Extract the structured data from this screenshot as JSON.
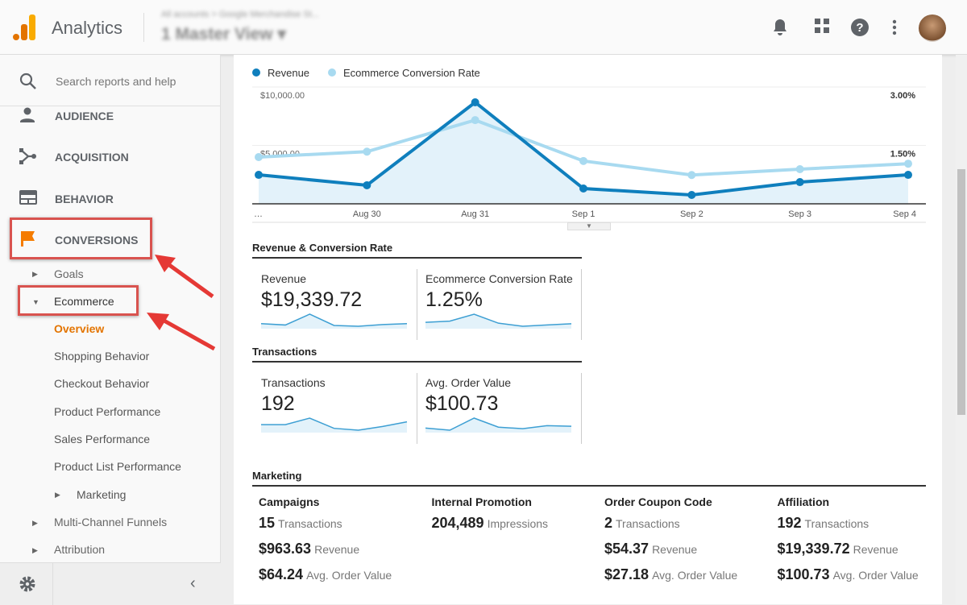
{
  "header": {
    "app_title": "Analytics",
    "breadcrumb": "All accounts > Google Merchandise St...",
    "view": "1 Master View ▾",
    "icons": [
      "bell-icon",
      "apps-grid-icon",
      "help-icon",
      "more-vert-icon"
    ]
  },
  "sidebar": {
    "search_placeholder": "Search reports and help",
    "sections": [
      {
        "label": "AUDIENCE",
        "icon": "person-icon"
      },
      {
        "label": "ACQUISITION",
        "icon": "acquisition-icon"
      },
      {
        "label": "BEHAVIOR",
        "icon": "behavior-icon"
      },
      {
        "label": "CONVERSIONS",
        "icon": "flag-icon"
      }
    ],
    "goals": "Goals",
    "ecommerce": "Ecommerce",
    "ecommerce_items": [
      "Overview",
      "Shopping Behavior",
      "Checkout Behavior",
      "Product Performance",
      "Sales Performance",
      "Product List Performance"
    ],
    "marketing": "Marketing",
    "multi_channel": "Multi-Channel Funnels",
    "attribution": "Attribution",
    "active_color": "#e37400"
  },
  "chart_data": {
    "type": "line",
    "categories": [
      "…",
      "Aug 30",
      "Aug 31",
      "Sep 1",
      "Sep 2",
      "Sep 3",
      "Sep 4"
    ],
    "series": [
      {
        "name": "Revenue",
        "color": "#0f7fbd",
        "axis": "left",
        "area": true,
        "values": [
          2480,
          1590,
          8690,
          1310,
          760,
          1860,
          2480
        ]
      },
      {
        "name": "Ecommerce Conversion Rate",
        "color": "#a8daf0",
        "axis": "right",
        "values": [
          1.2,
          1.34,
          2.15,
          1.1,
          0.74,
          0.89,
          1.03
        ]
      }
    ],
    "y_left": {
      "ticks": [
        "$10,000.00",
        "$5,000.00"
      ],
      "range": [
        0,
        10000
      ]
    },
    "y_right": {
      "ticks": [
        "3.00%",
        "1.50%"
      ],
      "range": [
        0,
        3
      ]
    },
    "grid": true,
    "legend": "top-left"
  },
  "sections": {
    "rev_conv": "Revenue & Conversion Rate",
    "transactions": "Transactions",
    "marketing": "Marketing"
  },
  "kpis": [
    {
      "title": "Revenue",
      "value": "$19,339.72",
      "spark": [
        2480,
        1590,
        8690,
        1310,
        760,
        1860,
        2480
      ]
    },
    {
      "title": "Ecommerce Conversion Rate",
      "value": "1.25%",
      "spark": [
        1.2,
        1.34,
        2.15,
        1.1,
        0.74,
        0.89,
        1.03
      ]
    },
    {
      "title": "Transactions",
      "value": "192",
      "spark": [
        24,
        24,
        31,
        20,
        18,
        22,
        27
      ]
    },
    {
      "title": "Avg. Order Value",
      "value": "$100.73",
      "spark": [
        102,
        95,
        135,
        105,
        100,
        110,
        108
      ]
    }
  ],
  "marketing": [
    {
      "title": "Campaigns",
      "rows": [
        {
          "v": "15",
          "u": "Transactions"
        },
        {
          "v": "$963.63",
          "u": "Revenue"
        },
        {
          "v": "$64.24",
          "u": "Avg. Order Value"
        }
      ]
    },
    {
      "title": "Internal Promotion",
      "rows": [
        {
          "v": "204,489",
          "u": "Impressions"
        }
      ]
    },
    {
      "title": "Order Coupon Code",
      "rows": [
        {
          "v": "2",
          "u": "Transactions"
        },
        {
          "v": "$54.37",
          "u": "Revenue"
        },
        {
          "v": "$27.18",
          "u": "Avg. Order Value"
        }
      ]
    },
    {
      "title": "Affiliation",
      "rows": [
        {
          "v": "192",
          "u": "Transactions"
        },
        {
          "v": "$19,339.72",
          "u": "Revenue"
        },
        {
          "v": "$100.73",
          "u": "Avg. Order Value"
        }
      ]
    }
  ]
}
